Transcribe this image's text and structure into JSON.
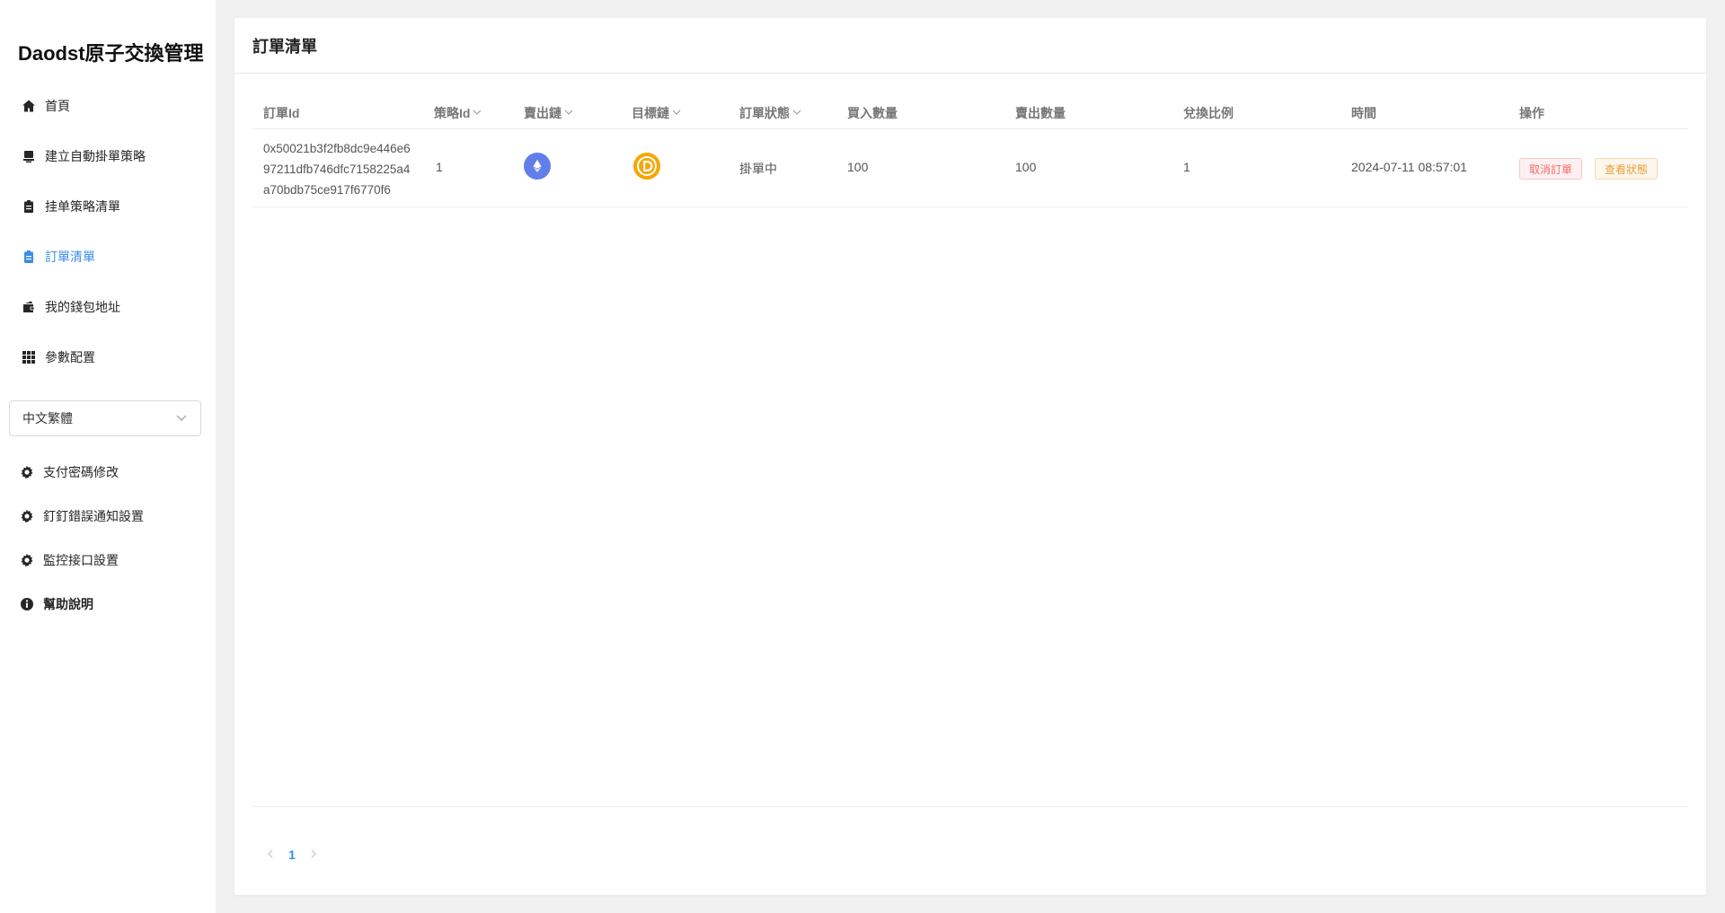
{
  "app": {
    "title": "Daodst原子交換管理"
  },
  "sidebar": {
    "items": [
      {
        "label": "首頁",
        "icon": "home-icon"
      },
      {
        "label": "建立自動掛單策略",
        "icon": "stamp-icon"
      },
      {
        "label": "挂单策略清單",
        "icon": "clipboard-icon"
      },
      {
        "label": "訂單清單",
        "icon": "clipboard-icon",
        "active": true
      },
      {
        "label": "我的錢包地址",
        "icon": "wallet-icon"
      },
      {
        "label": "參數配置",
        "icon": "grid-icon"
      }
    ],
    "language": {
      "selected": "中文繁體"
    },
    "settings": [
      {
        "label": "支付密碼修改",
        "icon": "gear-icon"
      },
      {
        "label": "釘釘錯誤通知設置",
        "icon": "gear-icon"
      },
      {
        "label": "監控接口設置",
        "icon": "gear-icon"
      },
      {
        "label": "幫助說明",
        "icon": "info-icon"
      }
    ]
  },
  "page": {
    "title": "訂單清單"
  },
  "table": {
    "columns": [
      "訂單Id",
      "策略Id",
      "賣出鏈",
      "目標鏈",
      "訂單狀態",
      "買入數量",
      "賣出數量",
      "兌換比例",
      "時間",
      "操作"
    ],
    "rows": [
      {
        "order_id": "0x50021b3f2fb8dc9e446e697211dfb746dfc7158225a4a70bdb75ce917f6770f6",
        "strategy_id": "1",
        "sell_chain_icon": "ethereum-icon",
        "target_chain_icon": "daodst-coin-icon",
        "status": "掛單中",
        "buy_amount": "100",
        "sell_amount": "100",
        "ratio": "1",
        "time": "2024-07-11 08:57:01",
        "actions": {
          "cancel": "取消訂單",
          "view_status": "查看狀態"
        }
      }
    ]
  },
  "pagination": {
    "current": "1"
  },
  "colors": {
    "accent": "#3a8ee6",
    "danger": "#f56c6c",
    "warning": "#e6a23c",
    "eth": "#627eea",
    "coin": "#f7a600"
  }
}
